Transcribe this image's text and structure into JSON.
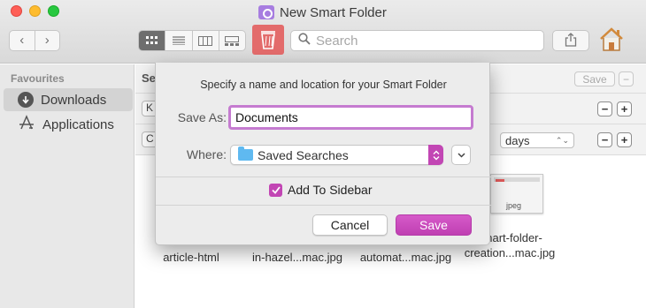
{
  "window": {
    "title": "New Smart Folder",
    "nav_back": "‹",
    "nav_forward": "›"
  },
  "toolbar": {
    "view_icons": [
      "grid-view-icon",
      "list-view-icon",
      "column-view-icon",
      "gallery-view-icon"
    ],
    "active_view": "grid",
    "search_placeholder": "Search",
    "trash_icon": "trash-icon",
    "share_icon": "share-icon",
    "home_icon": "home-icon"
  },
  "sidebar": {
    "header": "Favourites",
    "items": [
      {
        "label": "Downloads",
        "icon": "downloads-icon",
        "selected": true
      },
      {
        "label": "Applications",
        "icon": "applications-icon",
        "selected": false
      }
    ]
  },
  "main": {
    "search_label": "Se",
    "kind_popup": "K",
    "c_popup": "C",
    "save_button": "Save",
    "minus": "−",
    "plus": "+",
    "days_popup": "days",
    "thumb_label": "jpeg",
    "files": [
      {
        "line1": "",
        "line2": "article-html"
      },
      {
        "line1": "",
        "line2": "in-hazel...mac.jpg"
      },
      {
        "line1": "",
        "line2": "automat...mac.jpg"
      },
      {
        "line1": "smart-folder-",
        "line2": "creation...mac.jpg"
      }
    ]
  },
  "dialog": {
    "message": "Specify a name and location for your Smart Folder",
    "save_as_label": "Save As:",
    "save_as_value": "Documents",
    "where_label": "Where:",
    "where_value": "Saved Searches",
    "add_to_sidebar_label": "Add To Sidebar",
    "add_to_sidebar_checked": true,
    "cancel_label": "Cancel",
    "save_label": "Save"
  },
  "colors": {
    "accent": "#c246b4",
    "focus_ring": "#c57bd0",
    "folder": "#5fb9f0",
    "trash_bg": "#e36b6b"
  }
}
